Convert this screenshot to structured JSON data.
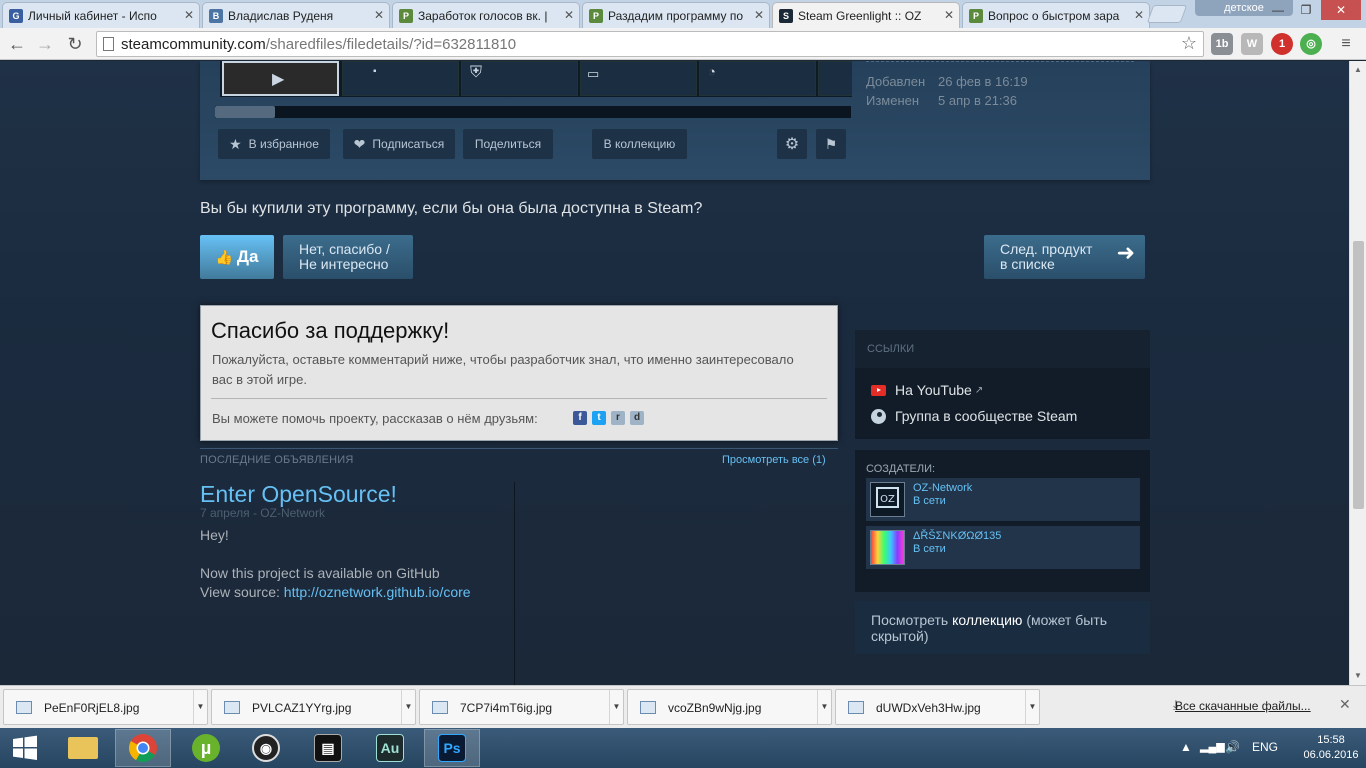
{
  "browser": {
    "tabs": [
      {
        "title": "Личный кабинет - Испо",
        "favicon": "G"
      },
      {
        "title": "Владислав Руденя",
        "favicon": "B"
      },
      {
        "title": "Заработок голосов вк. |",
        "favicon": "P"
      },
      {
        "title": "Раздадим программу по",
        "favicon": "P"
      },
      {
        "title": "Steam Greenlight :: OZ",
        "favicon": "S",
        "active": true
      },
      {
        "title": "Вопрос о быстром зара",
        "favicon": "P"
      }
    ],
    "profile_name": "детское",
    "url_host": "steamcommunity.com",
    "url_path": "/sharedfiles/filedetails/?id=632811810"
  },
  "item": {
    "favorite_label": "В избранное",
    "subscribe_label": "Подписаться",
    "share_label": "Поделиться",
    "collection_label": "В коллекцию",
    "added_label": "Добавлен",
    "added_value": "26 фев в 16:19",
    "changed_label": "Изменен",
    "changed_value": "5 апр в 21:36"
  },
  "vote": {
    "question": "Вы бы купили эту программу, если бы она была доступна в Steam?",
    "yes_label": "Да",
    "no_line1": "Нет, спасибо /",
    "no_line2": "Не интересно",
    "next_line1": "След. продукт",
    "next_line2": "в списке"
  },
  "thanks": {
    "title": "Спасибо за поддержку!",
    "desc": "Пожалуйста, оставьте комментарий ниже, чтобы разработчик знал, что именно заинтересовало вас в этой игре.",
    "share_text": "Вы можете помочь проекту, рассказав о нём друзьям:"
  },
  "announcements": {
    "heading": "ПОСЛЕДНИЕ ОБЪЯВЛЕНИЯ",
    "view_all": "Просмотреть все (1)",
    "title": "Enter OpenSource!",
    "date": "7 апреля - OZ-Network",
    "line1": "Hey!",
    "line2": "Now this project is available on GitHub",
    "line3_prefix": "View source:",
    "line3_link": "http://oznetwork.github.io/core"
  },
  "sidebar": {
    "links_heading": "ССЫЛКИ",
    "youtube_label": "На YouTube",
    "group_label": "Группа в сообществе Steam",
    "creators_heading": "СОЗДАТЕЛИ:",
    "creators": [
      {
        "name": "OZ-Network",
        "status": "В сети"
      },
      {
        "name": "ΔŘŠΣNKØΩØ135",
        "status": "В сети"
      }
    ],
    "collection_prefix": "Посмотреть",
    "collection_bold": "коллекцию",
    "collection_suffix": "(может быть скрытой)"
  },
  "downloads": {
    "files": [
      "PeEnF0RjEL8.jpg",
      "PVLCAZ1YYrg.jpg",
      "7CP7i4mT6ig.jpg",
      "vcoZBn9wNjg.jpg",
      "dUWDxVeh3Hw.jpg"
    ],
    "all_label": "Все скачанные файлы..."
  },
  "taskbar": {
    "lang": "ENG",
    "time": "15:58",
    "date": "06.06.2016",
    "apps": [
      "start",
      "explorer",
      "chrome",
      "utorrent",
      "obs",
      "video-editor",
      "audition",
      "photoshop"
    ],
    "audition_label": "Au",
    "photoshop_label": "Ps"
  },
  "colors": {
    "steam_bg": "#1b2838",
    "steam_link": "#66c0f4",
    "vote_yes": "#67c1f5"
  }
}
